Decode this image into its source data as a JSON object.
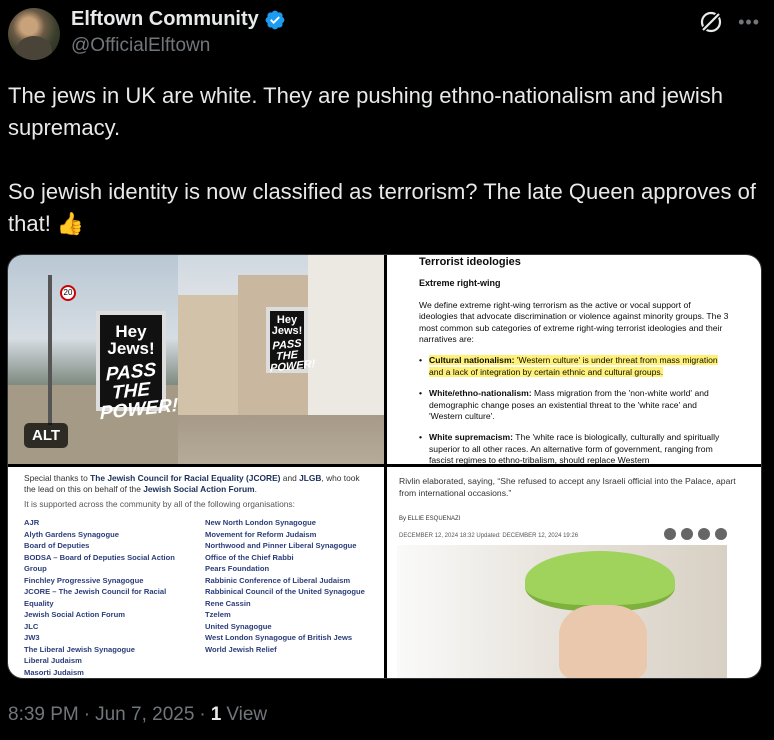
{
  "header": {
    "display_name": "Elftown Community",
    "handle": "@OfficialElftown",
    "verified": true
  },
  "tweet": {
    "paragraphs": [
      "The jews in UK are white. They are pushing ethno-nationalism and jewish supremacy.",
      "So jewish identity is now classified as terrorism? The late Queen approves of that! 👍"
    ]
  },
  "media": {
    "alt_badge": "ALT",
    "photo": {
      "poster_hey": "Hey Jews!",
      "poster_pass": "PASS THE POWER!",
      "speed_sign": "20"
    },
    "doc": {
      "title": "Terrorist ideologies",
      "subtitle": "Extreme right-wing",
      "intro": "We define extreme right-wing terrorism as the active or vocal support of ideologies that advocate discrimination or violence against minority groups. The 3 most common sub categories of extreme right-wing terrorist ideologies and their narratives are:",
      "items": [
        {
          "term": "Cultural nationalism:",
          "text": " 'Western culture' is under threat from mass migration and a lack of integration by certain ethnic and cultural groups.",
          "highlight": true
        },
        {
          "term": "White/ethno-nationalism:",
          "text": " Mass migration from the 'non-white world' and demographic change poses an existential threat to the 'white race' and 'Western culture'.",
          "highlight": false
        },
        {
          "term": "White supremacism:",
          "text": " The 'white race is biologically, culturally and spiritually superior to all other races. An alternative form of government, ranging from fascist regimes to ethno-tribalism, should replace Western",
          "highlight": false
        }
      ]
    },
    "orgs": {
      "intro_prefix": "Special thanks to ",
      "intro_org1": "The Jewish Council for Racial Equality (JCORE)",
      "intro_mid1": " and ",
      "intro_org2": "JLGB",
      "intro_mid2": ", who took the lead on this on behalf of the ",
      "intro_org3": "Jewish Social Action Forum",
      "intro_end": ".",
      "support": "It is supported across the community by all of the following organisations:",
      "left": [
        "AJR",
        "Alyth Gardens Synagogue",
        "Board of Deputies",
        "BODSA – Board of Deputies Social Action Group",
        "Finchley Progressive Synagogue",
        "JCORE – The Jewish Council for Racial Equality",
        "Jewish Social Action Forum",
        "JLC",
        "JW3",
        "The Liberal Jewish Synagogue",
        "Liberal Judaism",
        "Masorti Judaism"
      ],
      "right": [
        "New North London Synagogue",
        "Movement for Reform Judaism",
        "Northwood and Pinner Liberal Synagogue",
        "Office of the Chief Rabbi",
        "Pears Foundation",
        "Rabbinic Conference of Liberal Judaism",
        "Rabbinical Council of the United Synagogue",
        "Rene Cassin",
        "Tzelem",
        "United Synagogue",
        "West London Synagogue of British Jews",
        "World Jewish Relief"
      ]
    },
    "article": {
      "quote": "Rivlin elaborated, saying, “She refused to accept any Israeli official into the Palace, apart from international occasions.”",
      "byline": "By ELLIE ESQUENAZI",
      "dates": "DECEMBER 12, 2024 18:32   Updated: DECEMBER 12, 2024 19:26"
    }
  },
  "meta": {
    "time": "8:39 PM",
    "sep1": "·",
    "date": "Jun 7, 2025",
    "sep2": "·",
    "views_count": "1",
    "views_label": "View"
  },
  "colors": {
    "background": "#000000",
    "text": "#e7e9ea",
    "muted": "#71767b",
    "verified": "#1d9bf0",
    "highlight": "#fff176"
  }
}
